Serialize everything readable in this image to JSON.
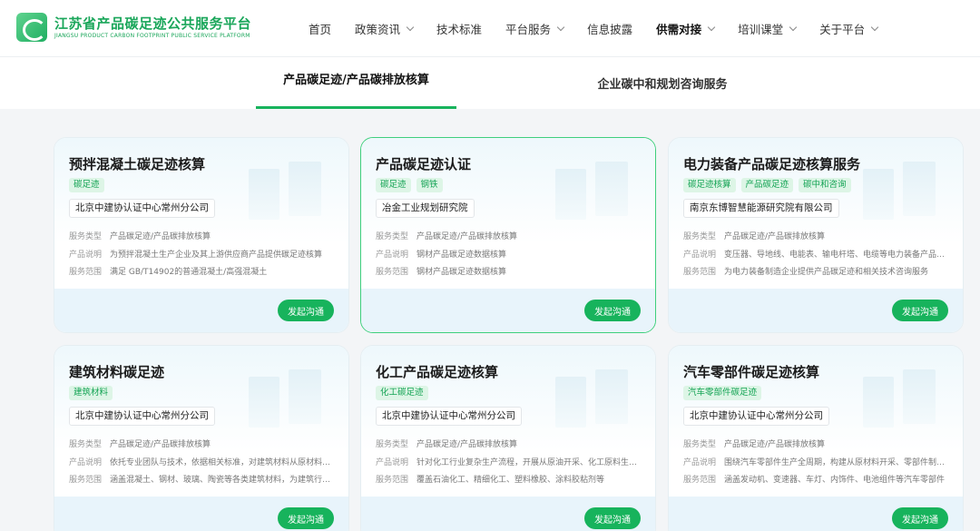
{
  "header": {
    "logo_cn": "江苏省产品碳足迹公共服务平台",
    "logo_en": "JIANGSU PRODUCT CARBON FOOTPRINT PUBLIC SERVICE PLATFORM",
    "nav": [
      {
        "label": "首页",
        "dropdown": false
      },
      {
        "label": "政策资讯",
        "dropdown": true
      },
      {
        "label": "技术标准",
        "dropdown": false
      },
      {
        "label": "平台服务",
        "dropdown": true
      },
      {
        "label": "信息披露",
        "dropdown": false
      },
      {
        "label": "供需对接",
        "dropdown": true,
        "active": true
      },
      {
        "label": "培训课堂",
        "dropdown": true
      },
      {
        "label": "关于平台",
        "dropdown": true
      }
    ]
  },
  "tabs": [
    {
      "label": "产品碳足迹/产品碳排放核算",
      "active": true
    },
    {
      "label": "企业碳中和规划咨询服务",
      "active": false
    }
  ],
  "labels": {
    "service_type": "服务类型",
    "product_desc": "产品说明",
    "service_scope": "服务范围",
    "button": "发起沟通"
  },
  "cards": [
    {
      "title": "预拌混凝土碳足迹核算",
      "tags": [
        "碳足迹"
      ],
      "org": "北京中建协认证中心常州分公司",
      "service_type": "产品碳足迹/产品碳排放核算",
      "product_desc": "为预拌混凝土生产企业及其上游供应商产品提供碳足迹核算",
      "service_scope": "满足 GB/T14902的普通混凝土/高强混凝土"
    },
    {
      "title": "产品碳足迹认证",
      "tags": [
        "碳足迹",
        "钢铁"
      ],
      "org": "冶金工业规划研究院",
      "service_type": "产品碳足迹/产品碳排放核算",
      "product_desc": "钢材产品碳足迹数据核算",
      "service_scope": "钢材产品碳足迹数据核算"
    },
    {
      "title": "电力装备产品碳足迹核算服务",
      "tags": [
        "碳足迹核算",
        "产品碳足迹",
        "碳中和咨询"
      ],
      "org": "南京东博智慧能源研究院有限公司",
      "service_type": "产品碳足迹/产品碳排放核算",
      "product_desc": "变压器、导地线、电能表、输电杆塔、电缆等电力装备产品碳足迹核算",
      "service_scope": "为电力装备制造企业提供产品碳足迹和相关技术咨询服务"
    },
    {
      "title": "建筑材料碳足迹",
      "tags": [
        "建筑材料"
      ],
      "org": "北京中建协认证中心常州分公司",
      "service_type": "产品碳足迹/产品碳排放核算",
      "product_desc": "依托专业团队与技术，依据相关标准，对建筑材料从原材料获取到生产全过程碳足迹核算",
      "service_scope": "涵盖混凝土、钢材、玻璃、陶瓷等各类建筑材料，为建筑行业提供服务"
    },
    {
      "title": "化工产品碳足迹核算",
      "tags": [
        "化工碳足迹"
      ],
      "org": "北京中建协认证中心常州分公司",
      "service_type": "产品碳足迹/产品碳排放核算",
      "product_desc": "针对化工行业复杂生产流程，开展从原油开采、化工原料生产到产品的核算",
      "service_scope": "覆盖石油化工、精细化工、塑料橡胶、涂料胶粘剂等"
    },
    {
      "title": "汽车零部件碳足迹核算",
      "tags": [
        "汽车零部件碳足迹"
      ],
      "org": "北京中建协认证中心常州分公司",
      "service_type": "产品碳足迹/产品碳排放核算",
      "product_desc": "围绕汽车零部件生产全周期，构建从原材料开采、零部件制造到装配的核算",
      "service_scope": "涵盖发动机、变速器、车灯、内饰件、电池组件等汽车零部件"
    }
  ]
}
